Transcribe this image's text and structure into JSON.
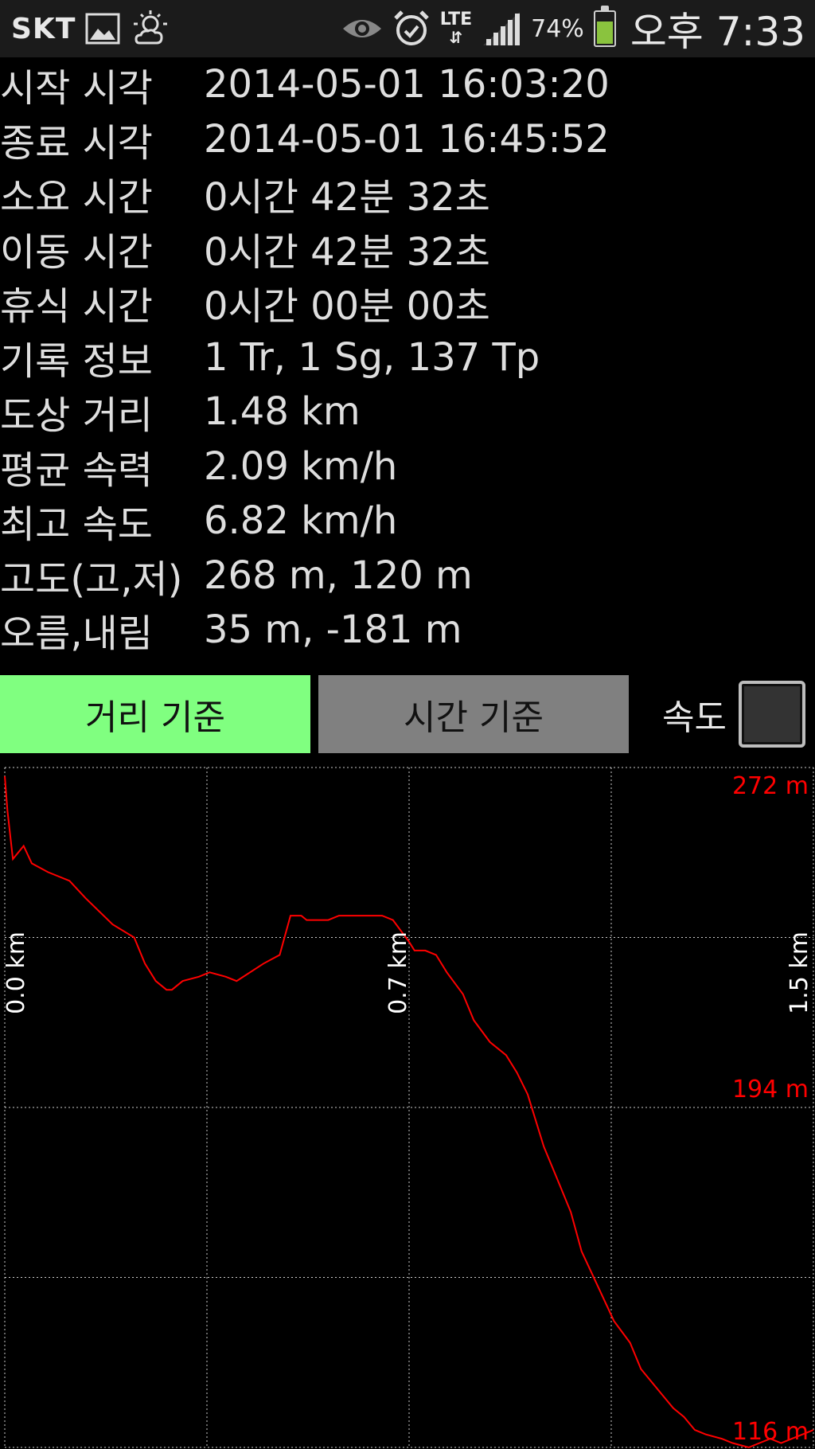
{
  "status_bar": {
    "carrier": "SKT",
    "icons": [
      "gallery-icon",
      "weather-icon",
      "eye-icon",
      "alarm-icon",
      "lte-icon",
      "signal-icon",
      "battery-icon"
    ],
    "lte_label": "LTE",
    "battery_percent": "74%",
    "battery_level": 0.74,
    "time": "오후 7:33"
  },
  "track_info": {
    "rows": [
      {
        "label": "시작 시각",
        "value": "2014-05-01 16:03:20"
      },
      {
        "label": "종료 시각",
        "value": "2014-05-01 16:45:52"
      },
      {
        "label": "소요 시간",
        "value": "0시간 42분 32초"
      },
      {
        "label": "이동 시간",
        "value": "0시간 42분 32초"
      },
      {
        "label": "휴식 시간",
        "value": "0시간 00분 00초"
      },
      {
        "label": "기록 정보",
        "value": "1 Tr, 1 Sg, 137 Tp"
      },
      {
        "label": "도상 거리",
        "value": "1.48 km"
      },
      {
        "label": "평균 속력",
        "value": "2.09 km/h"
      },
      {
        "label": "최고 속도",
        "value": "6.82 km/h"
      },
      {
        "label": "고도(고,저)",
        "value": "268 m, 120 m"
      },
      {
        "label": "오름,내림",
        "value": "35 m, -181 m"
      }
    ]
  },
  "toolbar": {
    "distance_button": "거리 기준",
    "time_button": "시간 기준",
    "speed_label": "속도",
    "speed_checked": false,
    "active_mode": "distance"
  },
  "colors": {
    "distance_button_bg": "#80ff80",
    "time_button_bg": "#808080",
    "line": "#ff0000",
    "grid": "#ffffff"
  },
  "chart_data": {
    "type": "line",
    "xlabel": "",
    "ylabel": "",
    "x_unit": "km",
    "y_unit": "m",
    "xlim": [
      0.0,
      1.5
    ],
    "ylim": [
      116,
      272
    ],
    "x_tick_labels": [
      "0.0 km",
      "0.7 km",
      "1.5 km"
    ],
    "y_tick_labels": [
      "272 m",
      "194 m",
      "116 m"
    ],
    "grid": true,
    "series": [
      {
        "values_x": [
          0.0,
          0.005,
          0.015,
          0.035,
          0.05,
          0.08,
          0.12,
          0.15,
          0.2,
          0.24,
          0.26,
          0.28,
          0.3,
          0.31,
          0.33,
          0.36,
          0.38,
          0.41,
          0.43,
          0.48,
          0.51,
          0.53,
          0.55,
          0.56,
          0.57,
          0.59,
          0.6,
          0.62,
          0.65,
          0.68,
          0.7,
          0.72,
          0.75,
          0.76,
          0.78,
          0.8,
          0.82,
          0.85,
          0.87,
          0.9,
          0.93,
          0.95,
          0.97,
          1.0,
          1.03,
          1.05,
          1.07,
          1.1,
          1.13,
          1.16,
          1.18,
          1.2,
          1.22,
          1.24,
          1.26,
          1.28,
          1.3,
          1.33,
          1.35,
          1.38,
          1.4,
          1.42,
          1.44,
          1.46,
          1.48,
          1.5
        ],
        "values_y": [
          270,
          262,
          251,
          254,
          250,
          248,
          246,
          242,
          236,
          233,
          227,
          223,
          221,
          221,
          223,
          224,
          225,
          224,
          223,
          227,
          229,
          238,
          238,
          237,
          237,
          237,
          237,
          238,
          238,
          238,
          238,
          237,
          232,
          230,
          230,
          229,
          225,
          220,
          214,
          209,
          206,
          202,
          197,
          185,
          176,
          170,
          161,
          153,
          145,
          140,
          134,
          131,
          128,
          125,
          123,
          120,
          119,
          118,
          117,
          116,
          117,
          118,
          117,
          118,
          119,
          120
        ]
      }
    ]
  }
}
